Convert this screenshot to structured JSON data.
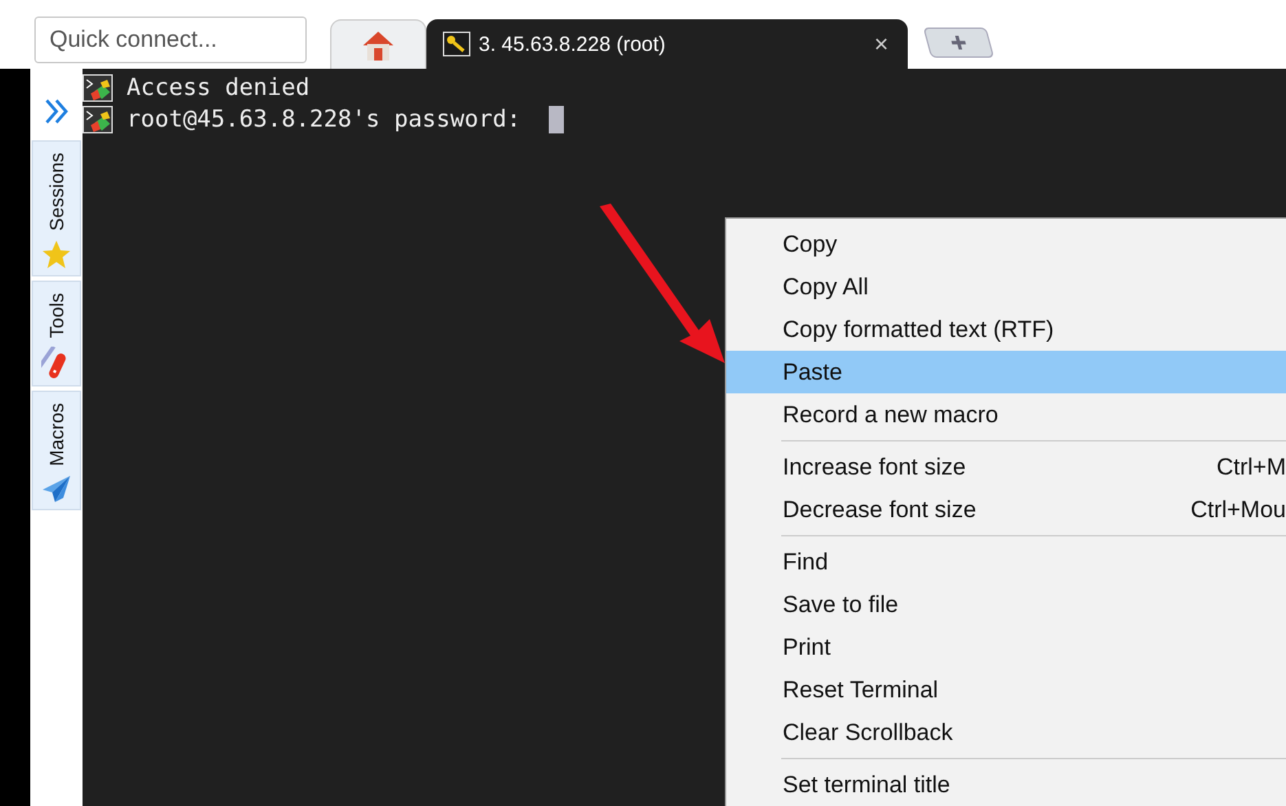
{
  "toolbar": {
    "quick_connect": {
      "placeholder": "Quick connect..."
    }
  },
  "tabs": [
    {
      "kind": "home",
      "selected": false
    },
    {
      "kind": "session",
      "label": "3. 45.63.8.228 (root)",
      "close": "×",
      "selected": true
    },
    {
      "kind": "new"
    }
  ],
  "sidebar": {
    "items": [
      {
        "label": "Sessions",
        "kind": "star"
      },
      {
        "label": "Tools",
        "kind": "tools"
      },
      {
        "label": "Macros",
        "kind": "plane"
      }
    ]
  },
  "terminal": {
    "lines": [
      {
        "text": "Access denied",
        "cursor": false
      },
      {
        "text": "root@45.63.8.228's password: ",
        "cursor": true
      }
    ]
  },
  "context_menu": {
    "groups": [
      [
        {
          "label": "Copy",
          "selected": false
        },
        {
          "label": "Copy All",
          "selected": false
        },
        {
          "label": "Copy formatted text (RTF)",
          "selected": false
        },
        {
          "label": "Paste",
          "selected": true
        },
        {
          "label": "Record a new macro",
          "selected": false
        }
      ],
      [
        {
          "label": "Increase font size",
          "shortcut": "Ctrl+M",
          "selected": false
        },
        {
          "label": "Decrease font size",
          "shortcut": "Ctrl+Mou",
          "selected": false
        }
      ],
      [
        {
          "label": "Find",
          "selected": false
        },
        {
          "label": "Save to file",
          "selected": false
        },
        {
          "label": "Print",
          "selected": false
        },
        {
          "label": "Reset Terminal",
          "selected": false
        },
        {
          "label": "Clear Scrollback",
          "selected": false
        }
      ],
      [
        {
          "label": "Set terminal title",
          "selected": false
        }
      ]
    ]
  }
}
